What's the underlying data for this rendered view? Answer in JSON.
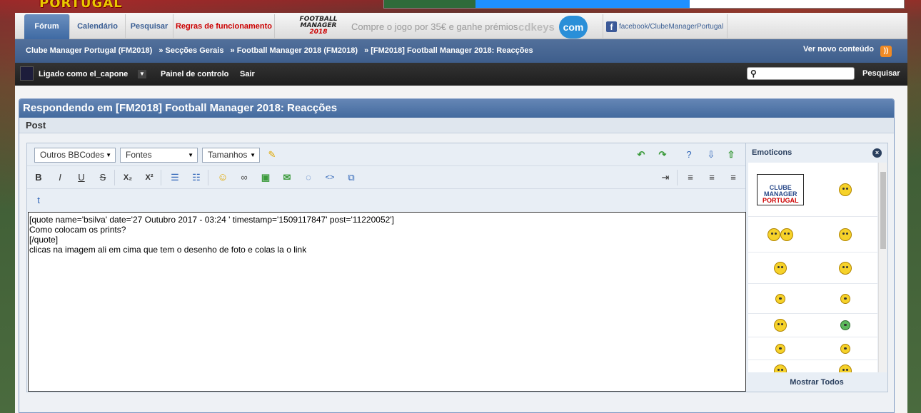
{
  "header": {
    "logo_text": "PORTUGAL",
    "nav_tabs": [
      {
        "label": "Fórum",
        "active": true
      },
      {
        "label": "Calendário"
      },
      {
        "label": "Pesquisar"
      },
      {
        "label": "Regras de funcionamento"
      }
    ],
    "ad": {
      "fm_line1": "FOOTBALL",
      "fm_line2": "MANAGER",
      "fm_year": "2018",
      "promo_text": "Compre o jogo por 35€ e ganhe prémios",
      "cdkeys": "cdkeys",
      "com": "com"
    },
    "facebook_link": "facebook/ClubeManagerPortugal"
  },
  "breadcrumb": {
    "items": [
      "Clube Manager Portugal (FM2018)",
      "» Secções Gerais",
      "» Football Manager 2018 (FM2018)",
      "» [FM2018] Football Manager 2018: Reacções"
    ],
    "new_content": "Ver novo conteúdo"
  },
  "userbar": {
    "logged_as": "Ligado como el_capone",
    "control_panel": "Painel de controlo",
    "logout": "Sair",
    "search_placeholder": "",
    "search_button": "Pesquisar"
  },
  "panel": {
    "title": "Respondendo em [FM2018] Football Manager 2018: Reacções",
    "subtitle": "Post"
  },
  "editor": {
    "selects": [
      "Outros BBCodes",
      "Fontes",
      "Tamanhos"
    ],
    "content": "[quote name='bsilva' date='27 Outubro 2017 - 03:24 ' timestamp='1509117847' post='11220052']\nComo colocam os prints?\n[/quote]\nclicas na imagem ali em cima que tem o desenho de foto e colas la o link"
  },
  "emoticons": {
    "title": "Emoticons",
    "show_all": "Mostrar Todos",
    "sign_line1": "CLUBE",
    "sign_line2": "MANAGER",
    "sign_line3": "PORTUGAL"
  }
}
